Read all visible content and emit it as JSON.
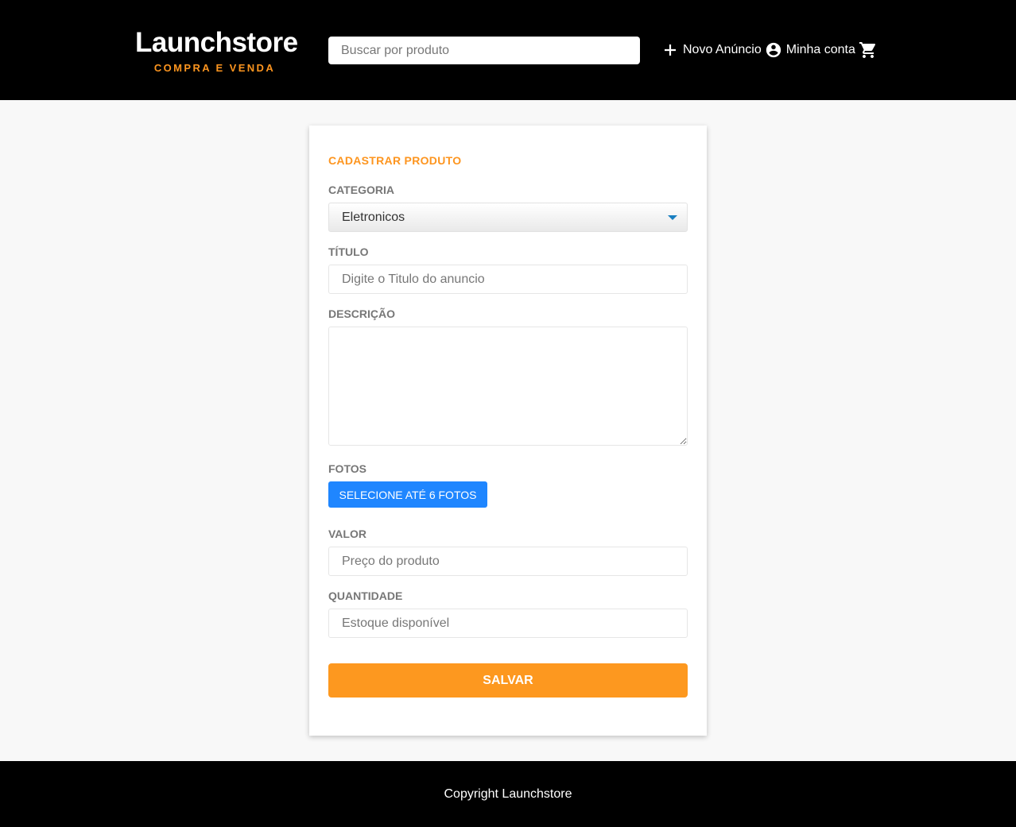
{
  "header": {
    "logo_title": "Launchstore",
    "logo_subtitle": "COMPRA E VENDA",
    "search_placeholder": "Buscar por produto",
    "nav": {
      "new_ad": "Novo Anúncio",
      "account": "Minha conta"
    },
    "icons": [
      "plus-icon",
      "account-circle-icon",
      "cart-icon"
    ]
  },
  "form": {
    "title": "CADASTRAR PRODUTO",
    "category_label": "CATEGORIA",
    "category_value": "Eletronicos",
    "title_label": "TÍTULO",
    "title_placeholder": "Digite o Titulo do anuncio",
    "description_label": "DESCRIÇÃO",
    "description_value": "",
    "photos_label": "FOTOS",
    "photos_button": "SELECIONE ATÉ 6 FOTOS",
    "price_label": "VALOR",
    "price_placeholder": "Preço do produto",
    "quantity_label": "QUANTIDADE",
    "quantity_placeholder": "Estoque disponível",
    "save_button": "SALVAR"
  },
  "footer": {
    "copyright": "Copyright Launchstore"
  },
  "colors": {
    "header_bg": "#000000",
    "accent_orange": "#fd951f",
    "photo_button_blue": "#1f86ff",
    "page_bg": "#f8f8f8"
  }
}
